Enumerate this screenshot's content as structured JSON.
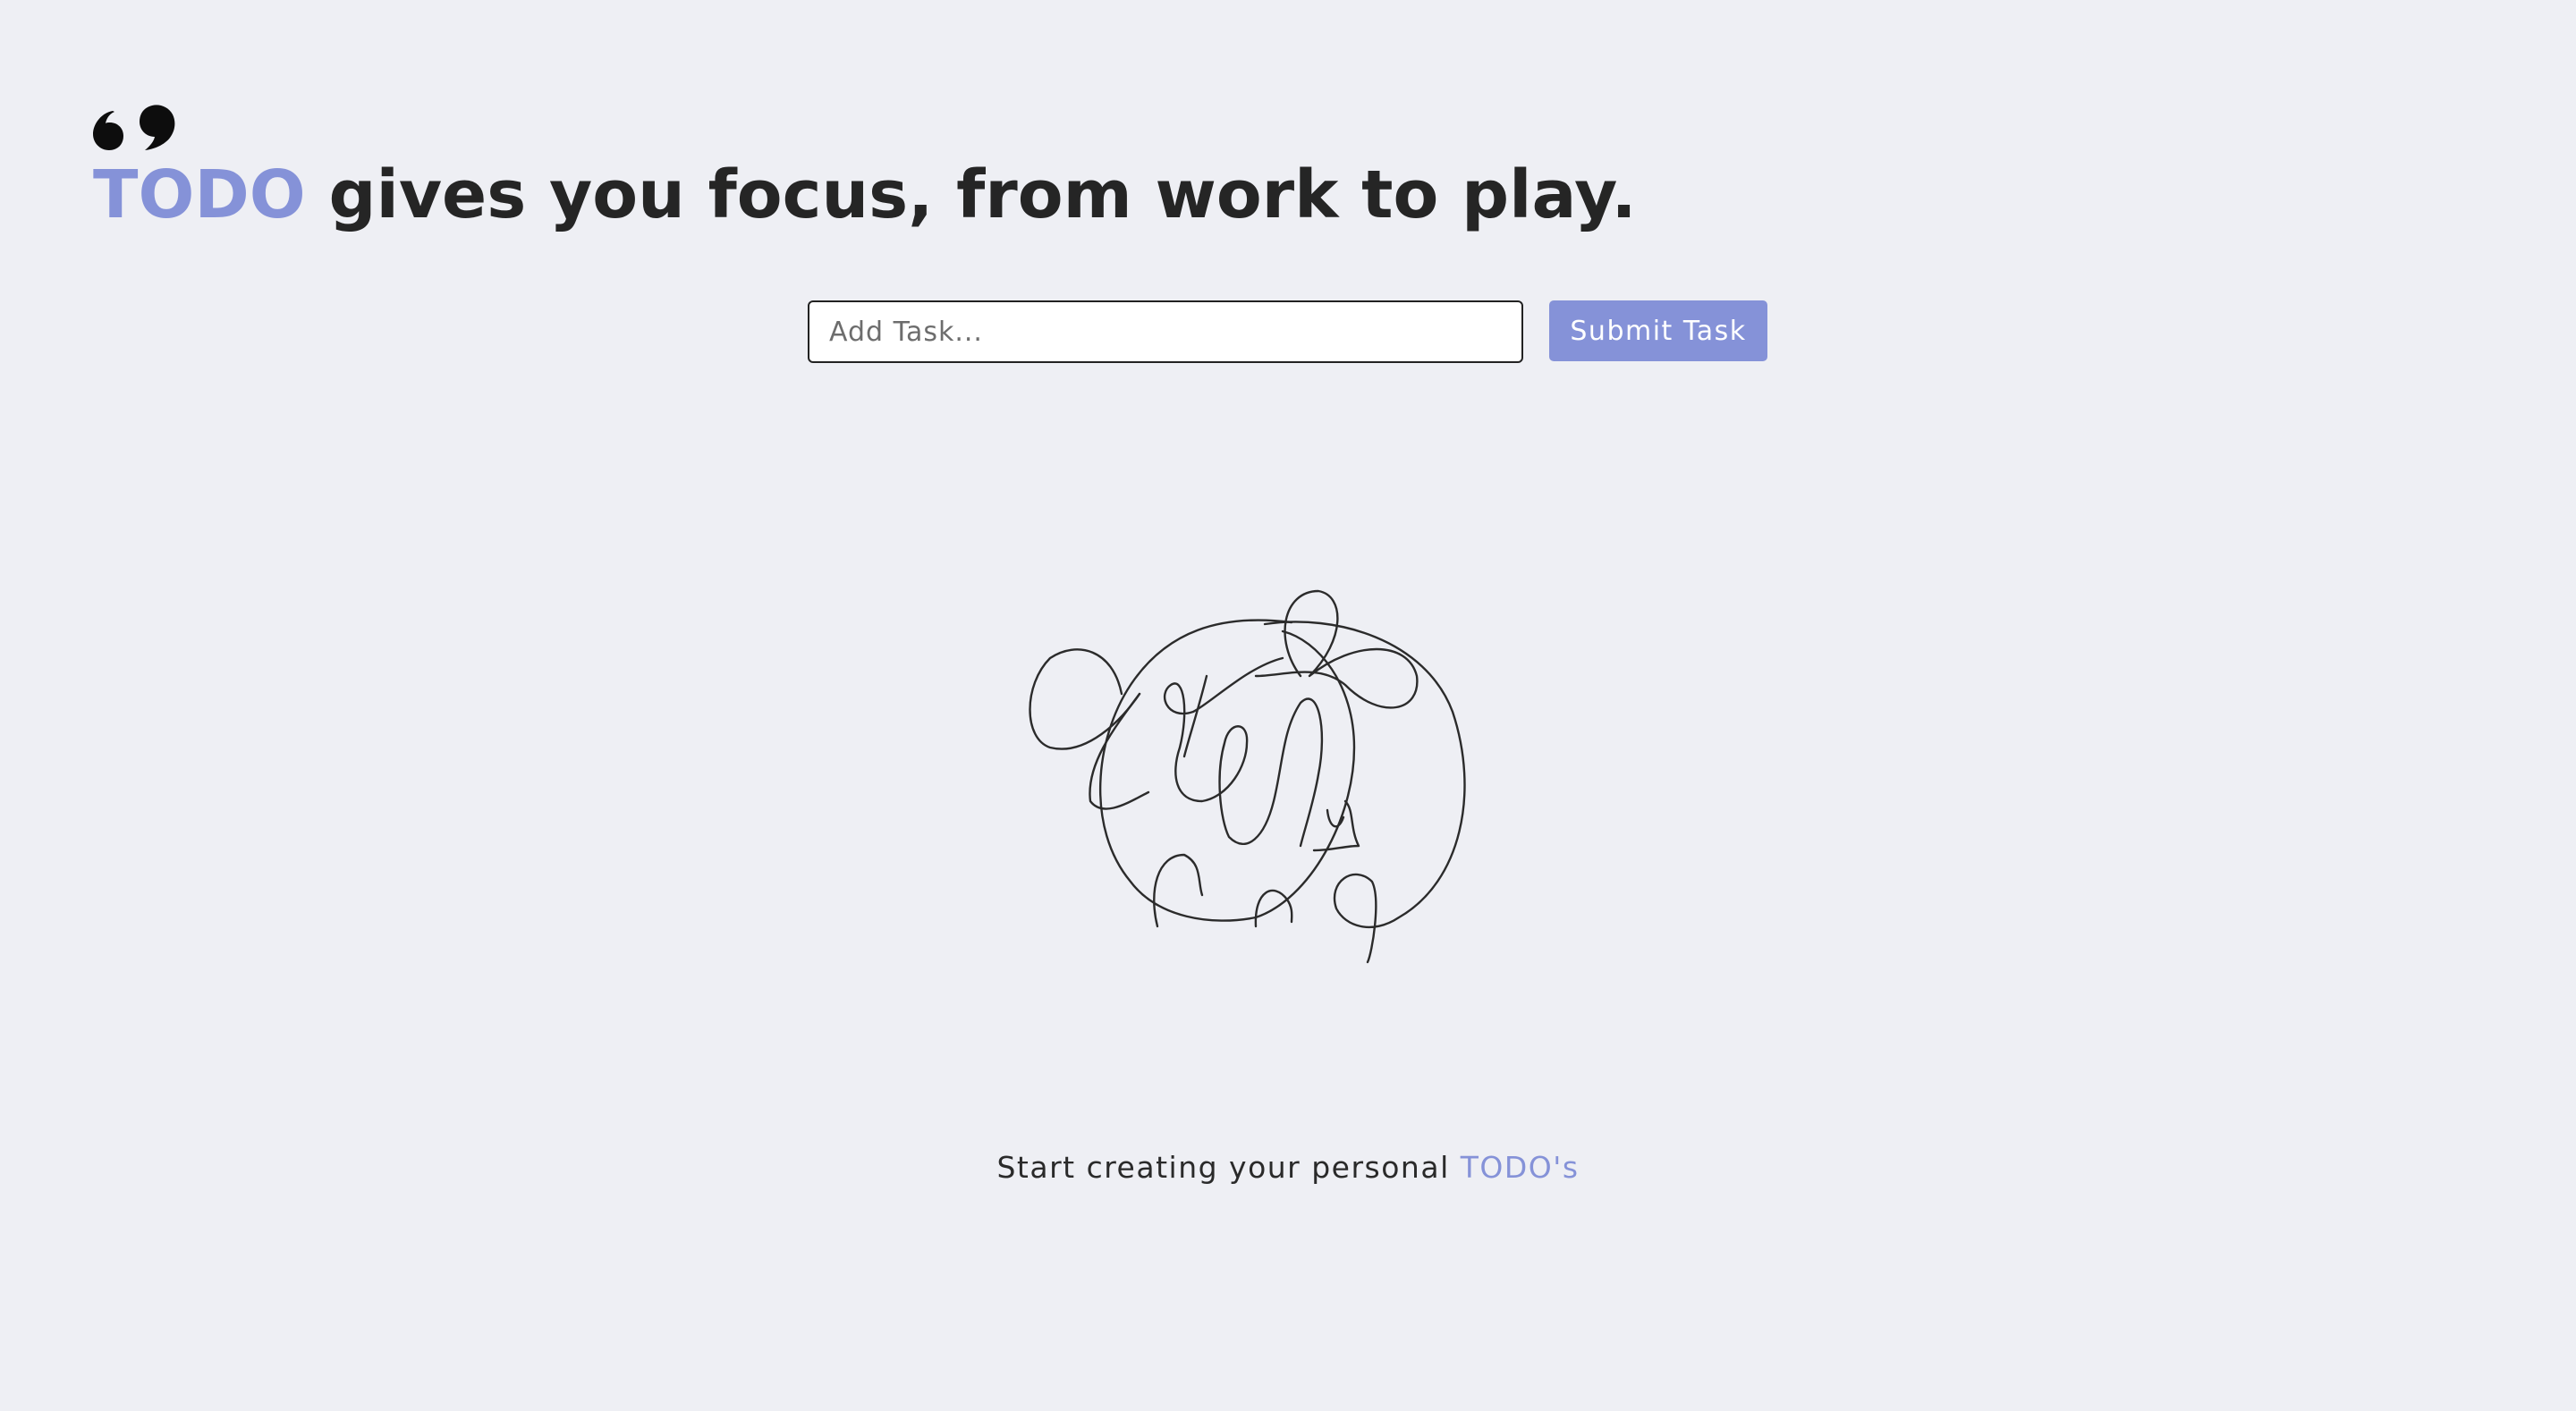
{
  "header": {
    "quote_icon": "quote-mark-icon",
    "title_accent": "TODO",
    "title_rest": " gives you focus, from work to play."
  },
  "task_form": {
    "input_value": "",
    "input_placeholder": "Add Task...",
    "submit_label": "Submit Task"
  },
  "empty_state": {
    "illustration_icon": "scribble-line-drawing-icon",
    "message_prefix": "Start creating your personal ",
    "message_accent": "TODO's"
  },
  "colors": {
    "accent": "#8592d8",
    "background": "#eeeff4",
    "text": "#252525"
  }
}
